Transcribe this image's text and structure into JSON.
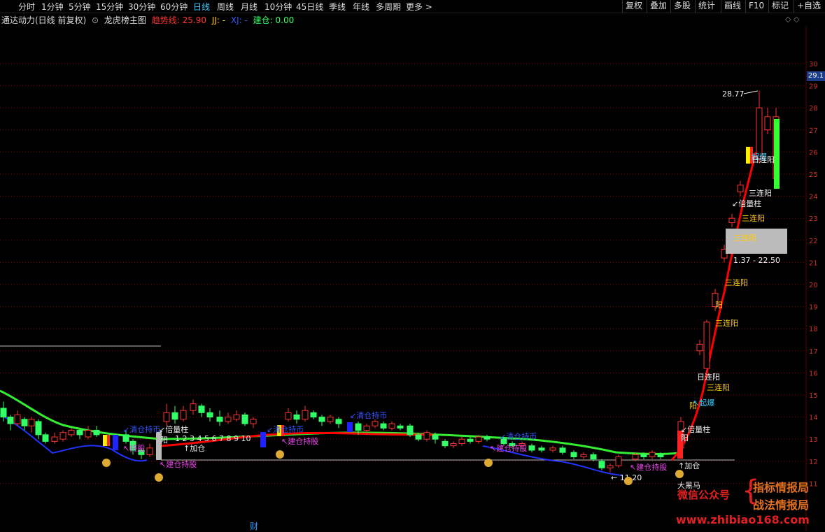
{
  "toolbar": {
    "timeframes": [
      "分时",
      "1分钟",
      "5分钟",
      "15分钟",
      "30分钟",
      "60分钟",
      "日线",
      "周线",
      "月线",
      "10分钟",
      "45日线",
      "季线",
      "年线",
      "多周期",
      "更多 >"
    ],
    "active_timeframe": "日线",
    "right_buttons": [
      "复权",
      "叠加",
      "多股",
      "统计",
      "画线",
      "F10",
      "标记",
      "+自选"
    ]
  },
  "legend": {
    "indicator": "通达动力(日线 前复权)",
    "main_chart": "龙虎榜主图",
    "trend_label": "趋势线: 25.90",
    "jj_label": "JJ: -",
    "xj_label": "XJ: -",
    "jiancang_label": "建仓: 0.00"
  },
  "price_axis": {
    "ticks": [
      "30",
      "29",
      "28",
      "27",
      "26",
      "25",
      "24",
      "23",
      "22",
      "21",
      "20",
      "19",
      "18",
      "17",
      "16",
      "15",
      "14",
      "13",
      "12",
      "11"
    ],
    "current_price_tag": "29.1"
  },
  "annotations": {
    "high_label": "28.77",
    "low_label": "11.20",
    "range_label": "1.37 - 22.50",
    "qingcang_chibi": "清仓持币",
    "jiancang_chigu": "建仓持股",
    "beiliangzhu": "倍量柱",
    "jiacang": "加仓",
    "sanlianyang": "三连阳",
    "yang": "阳",
    "qibao": "起爆",
    "rijuxian": "日连阳",
    "heima": "大黑马",
    "chigu": "持股",
    "count_seq": "1 2 3 4 5 6 7 8 9 10"
  },
  "watermark": {
    "wechat": "微信公众号",
    "brand1": "指标情报局",
    "brand2": "战法情报局",
    "url": "www.zhibiao168.com",
    "brace": "{"
  },
  "bottom_marker": "财",
  "colors": {
    "up": "#ff3333",
    "down": "#33ff66",
    "trend": "#ff0000",
    "green_ma": "#33ee33",
    "blue_ma": "#2233ff",
    "grid": "#880000"
  },
  "chart_data": {
    "type": "candlestick",
    "price_range": [
      11,
      30
    ],
    "trend_line_value": 25.9
  }
}
